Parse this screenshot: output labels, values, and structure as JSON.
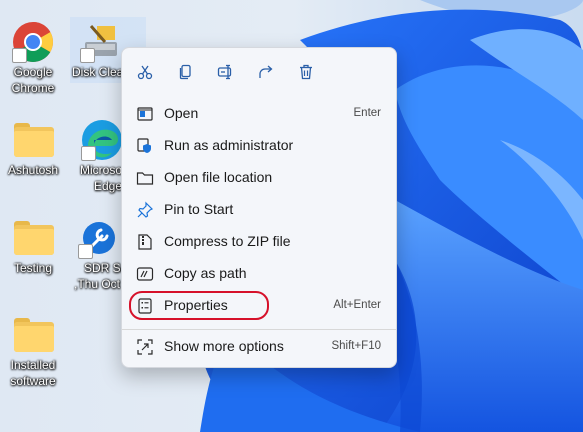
{
  "desktop": {
    "icons": [
      {
        "label": "Google Chrome",
        "label_line1": "Google",
        "label_line2": "Chrome"
      },
      {
        "label": "Disk Clea"
      },
      {
        "label": "Ashutosh"
      },
      {
        "label": "Microso Edge",
        "label_line1": "Microso",
        "label_line2": "Edge"
      },
      {
        "label": "Testing"
      },
      {
        "label": "SDR Sc ,Thu Oct",
        "label_line1": "SDR Sc",
        "label_line2": ",Thu Oct"
      },
      {
        "label": "Installed software",
        "label_line1": "Installed",
        "label_line2": "software"
      }
    ]
  },
  "context_menu": {
    "toolbar": [
      {
        "icon": "cut-icon"
      },
      {
        "icon": "copy-icon"
      },
      {
        "icon": "rename-icon"
      },
      {
        "icon": "share-icon"
      },
      {
        "icon": "delete-icon"
      }
    ],
    "items": [
      {
        "label": "Open",
        "shortcut": "Enter",
        "icon": "open-icon"
      },
      {
        "label": "Run as administrator",
        "shortcut": "",
        "icon": "shield-icon"
      },
      {
        "label": "Open file location",
        "shortcut": "",
        "icon": "folder-icon"
      },
      {
        "label": "Pin to Start",
        "shortcut": "",
        "icon": "pin-icon"
      },
      {
        "label": "Compress to ZIP file",
        "shortcut": "",
        "icon": "zip-icon"
      },
      {
        "label": "Copy as path",
        "shortcut": "",
        "icon": "path-icon"
      },
      {
        "label": "Properties",
        "shortcut": "Alt+Enter",
        "icon": "properties-icon"
      },
      {
        "label": "Show more options",
        "shortcut": "Shift+F10",
        "icon": "more-options-icon"
      }
    ],
    "highlighted_item": "Properties",
    "highlight_color": "#d6112a"
  },
  "colors": {
    "accent": "#0a5ad6",
    "wallpaper_blue": "#1565e0"
  }
}
